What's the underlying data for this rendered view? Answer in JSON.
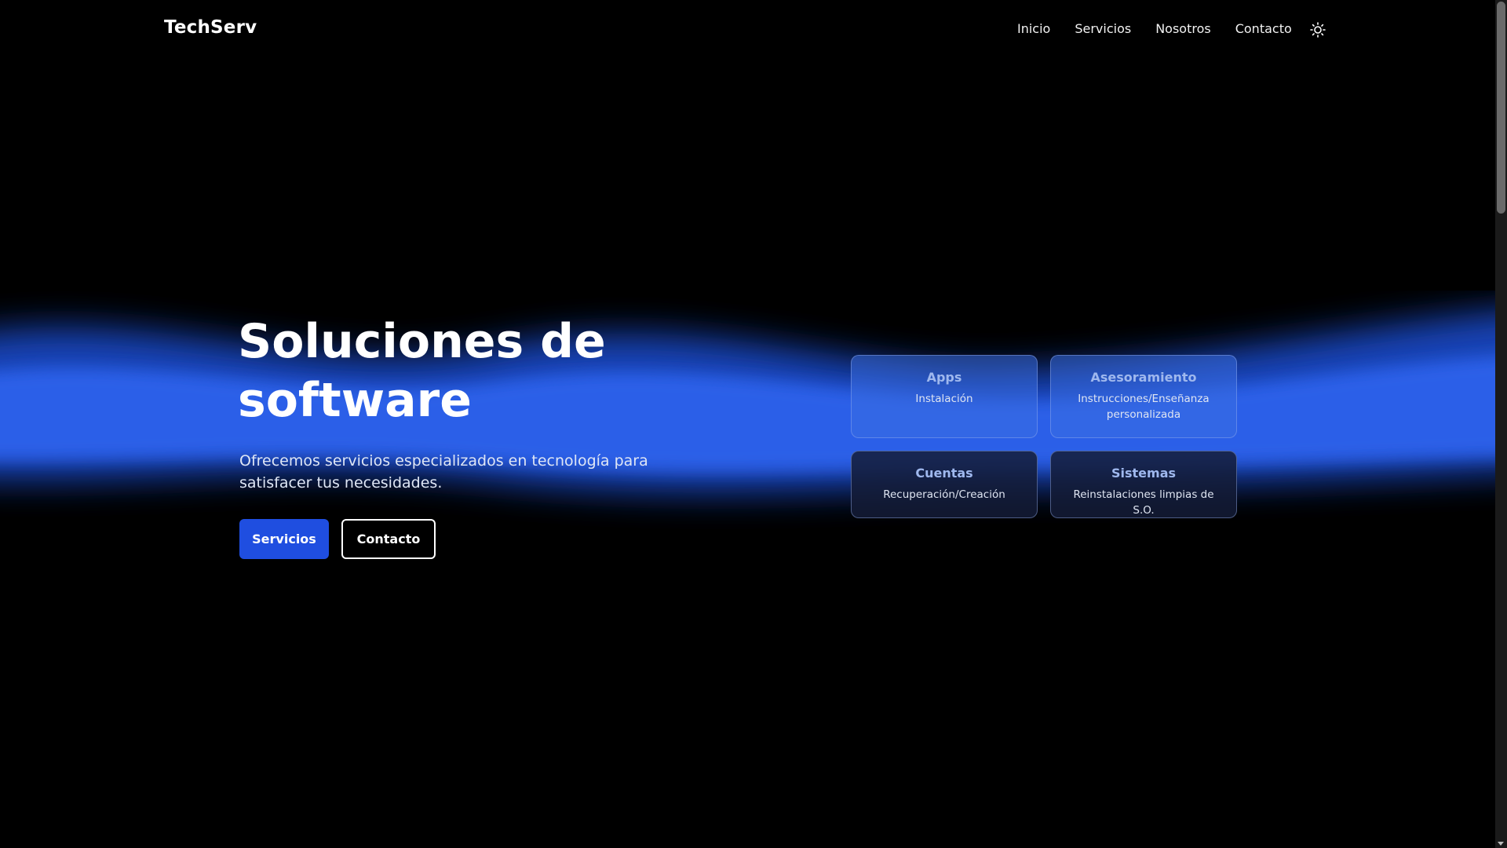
{
  "header": {
    "logo": "TechServ",
    "nav": [
      "Inicio",
      "Servicios",
      "Nosotros",
      "Contacto"
    ],
    "theme_toggle_icon": "sun-icon"
  },
  "hero": {
    "title": "Soluciones de software",
    "subtitle": "Ofrecemos servicios especializados en tecnología para satisfacer tus necesidades.",
    "primary_button": "Servicios",
    "secondary_button": "Contacto"
  },
  "services": [
    {
      "title": "Apps",
      "description": "Instalación"
    },
    {
      "title": "Asesoramiento",
      "description": "Instrucciones/Enseñanza personalizada"
    },
    {
      "title": "Cuentas",
      "description": "Recuperación/Creación"
    },
    {
      "title": "Sistemas",
      "description": "Reinstalaciones limpias de S.O."
    }
  ],
  "colors": {
    "background": "#000000",
    "accent": "#1f4ee0",
    "wave": "#2a5fe8",
    "card_title": "#9fb8ee"
  }
}
